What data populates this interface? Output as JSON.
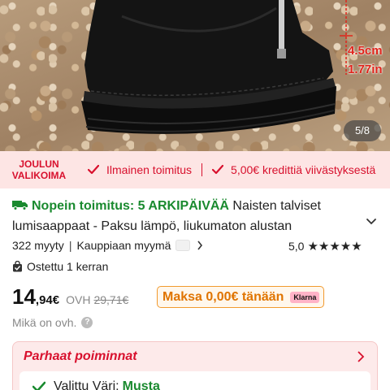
{
  "hero": {
    "dimension_cm": "4.5cm",
    "dimension_in": "1.77in",
    "page_counter": "5/8"
  },
  "promo": {
    "brand": "JOULUN VALIKOIMA",
    "items": [
      {
        "label": "Ilmainen toimitus",
        "icon": "check-icon"
      },
      {
        "label": "5,00€ kredittiä viivästyksestä",
        "icon": "check-icon"
      }
    ],
    "color": "#d8102d"
  },
  "title": {
    "fast_label": "Nopein toimitus: 5 ARKIPÄIVÄÄ",
    "product_name": "Naisten talviset lumisaappaat - Paksu lämpö, liukumaton alustan"
  },
  "stats": {
    "sold": "322 myyty",
    "seller": "Kauppiaan myymä",
    "rating": "5,0",
    "stars": "★★★★★",
    "bought": "Ostettu 1 kerran"
  },
  "price": {
    "integer": "14",
    "decimal": ",94€",
    "ovh_label": "OVH",
    "ovh_value": "29,71€",
    "klarna_text": "Maksa 0,00€ tänään",
    "klarna_logo": "Klarna"
  },
  "what_ovh": "Mikä on ovh.",
  "picks": {
    "heading": "Parhaat poiminnat",
    "variant_label": "Valittu Väri:",
    "variant_value": "Musta"
  },
  "colors": {
    "accent": "#d8102d",
    "green": "#1a8a2f",
    "klarna_orange": "#e07400"
  }
}
